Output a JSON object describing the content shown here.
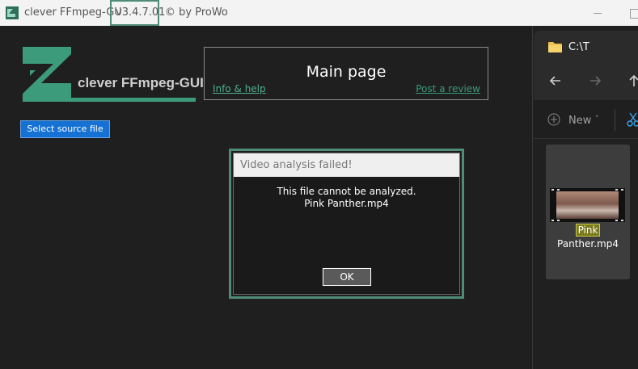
{
  "titlebar": {
    "app_name": "clever FFmpeg-GU",
    "version": "v3.4.7.01",
    "byline": "© by ProWo"
  },
  "logo": {
    "text": "clever FFmpeg-GUI",
    "accent_color": "#3c9b7b"
  },
  "mainbox": {
    "heading": "Main page",
    "info_link": "Info & help",
    "review_link": "Post a review"
  },
  "source_button": {
    "label": "Select source file",
    "color": "#1572d4"
  },
  "dialog": {
    "title": "Video analysis failed!",
    "message_line1": "This file cannot be analyzed.",
    "message_line2": "Pink Panther.mp4",
    "ok_label": "OK"
  },
  "explorer": {
    "path": "C:\\T",
    "nav_icons": [
      "back-arrow-icon",
      "forward-arrow-icon",
      "up-arrow-icon"
    ],
    "new_label": "New",
    "file": {
      "name_highlight": "Pink",
      "name_rest": "Panther.mp4"
    }
  }
}
